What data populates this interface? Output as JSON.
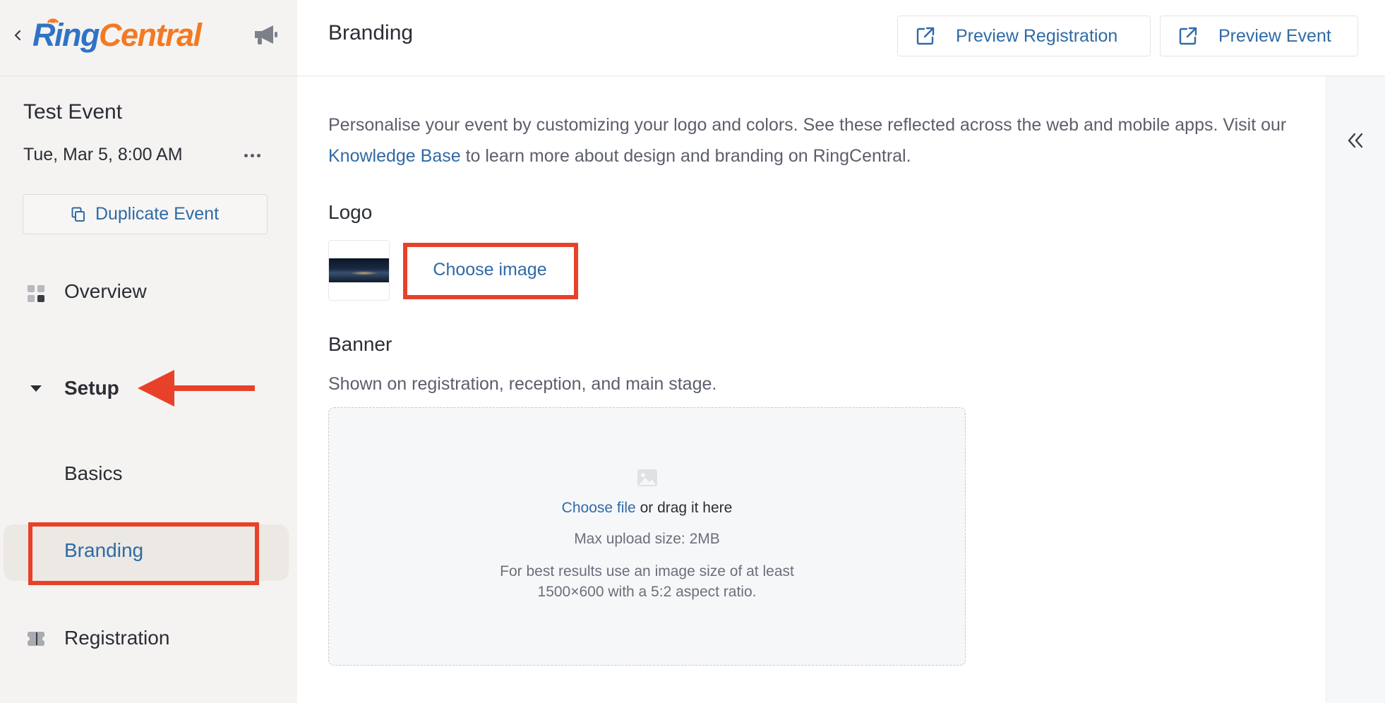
{
  "sidebar": {
    "logo": {
      "ring": "Ring",
      "central": "Central"
    },
    "event_title": "Test Event",
    "event_date": "Tue, Mar 5, 8:00 AM",
    "duplicate_label": "Duplicate Event",
    "nav": {
      "overview": "Overview",
      "setup": "Setup",
      "basics": "Basics",
      "branding": "Branding",
      "registration": "Registration"
    }
  },
  "header": {
    "title": "Branding",
    "preview_registration": "Preview Registration",
    "preview_event": "Preview Event"
  },
  "main": {
    "intro_part1": "Personalise your event by customizing your logo and colors. See these reflected across the web and mobile apps. Visit our ",
    "intro_link": "Knowledge Base",
    "intro_part2": " to learn more about design and branding on RingCentral.",
    "logo_title": "Logo",
    "choose_image": "Choose image",
    "banner_title": "Banner",
    "banner_sub": "Shown on registration, reception, and main stage.",
    "dropzone": {
      "choose_file": "Choose file",
      "drag_text": " or drag it here",
      "max_size": "Max upload size: 2MB",
      "hint": "For best results use an image size of at least 1500×600 with a 5:2 aspect ratio."
    }
  },
  "colors": {
    "accent": "#2f6aa6",
    "annotation_red": "#e8412a",
    "logo_blue": "#2f73c7",
    "logo_orange": "#f27a24",
    "sidebar_bg": "#f5f3f1"
  },
  "icons": [
    "back-chevron-icon",
    "megaphone-icon",
    "more-dots-icon",
    "duplicate-icon",
    "grid-icon",
    "caret-down-icon",
    "ticket-icon",
    "external-link-icon",
    "image-icon",
    "double-chevron-left-icon"
  ]
}
